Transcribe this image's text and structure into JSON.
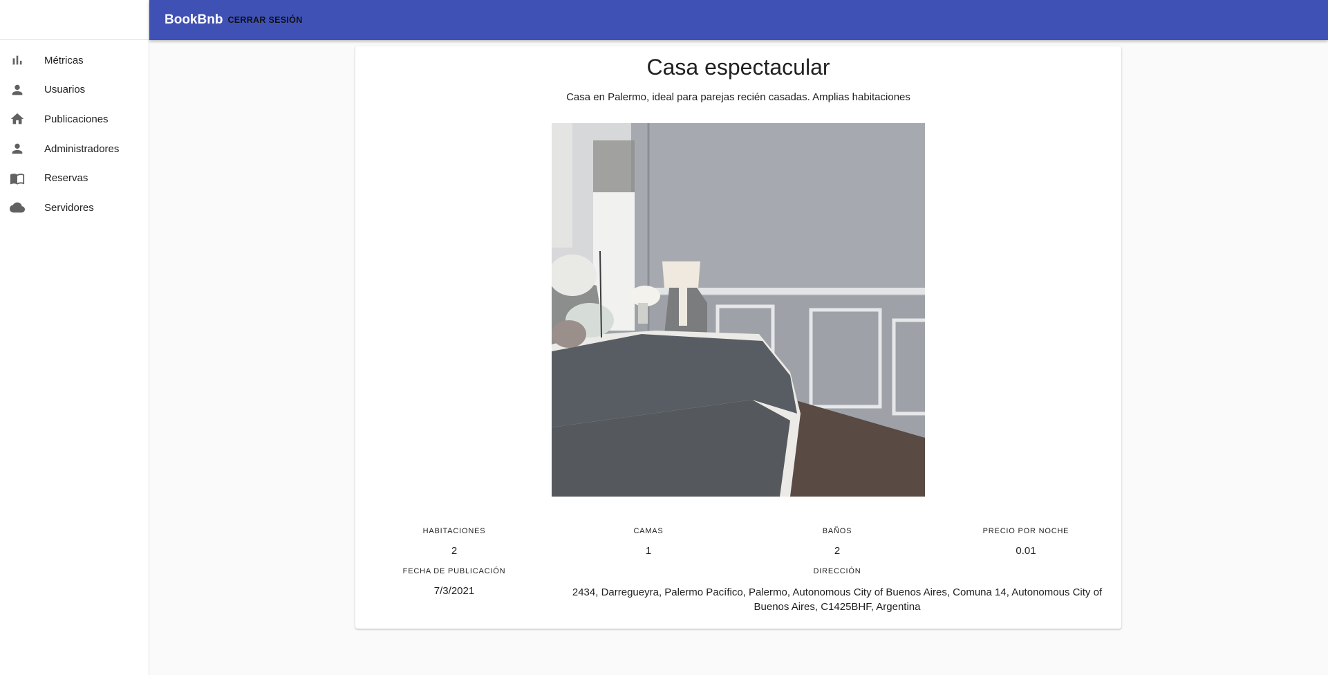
{
  "appbar": {
    "brand": "BookBnb",
    "logout_label": "CERRAR SESIÓN"
  },
  "sidebar": {
    "items": [
      {
        "label": "Métricas",
        "icon": "bar-chart-icon"
      },
      {
        "label": "Usuarios",
        "icon": "person-icon"
      },
      {
        "label": "Publicaciones",
        "icon": "home-icon"
      },
      {
        "label": "Administradores",
        "icon": "person-icon"
      },
      {
        "label": "Reservas",
        "icon": "book-icon"
      },
      {
        "label": "Servidores",
        "icon": "cloud-icon"
      }
    ]
  },
  "listing": {
    "title": "Casa espectacular",
    "description": "Casa en Palermo, ideal para parejas recién casadas. Amplias habitaciones",
    "photo": "bedroom-photo",
    "rooms_label": "HABITACIONES",
    "rooms": "2",
    "beds_label": "CAMAS",
    "beds": "1",
    "baths_label": "BAÑOS",
    "baths": "2",
    "price_label": "PRECIO POR NOCHE",
    "price": "0.01",
    "date_label": "FECHA DE PUBLICACIÓN",
    "date": "7/3/2021",
    "address_label": "DIRECCIÓN",
    "address": "2434, Darregueyra, Palermo Pacífico, Palermo, Autonomous City of Buenos Aires, Comuna 14, Autonomous City of Buenos Aires, C1425BHF, Argentina"
  },
  "colors": {
    "appbar": "#3f51b5",
    "background": "#fafafa",
    "icon": "#616161"
  }
}
